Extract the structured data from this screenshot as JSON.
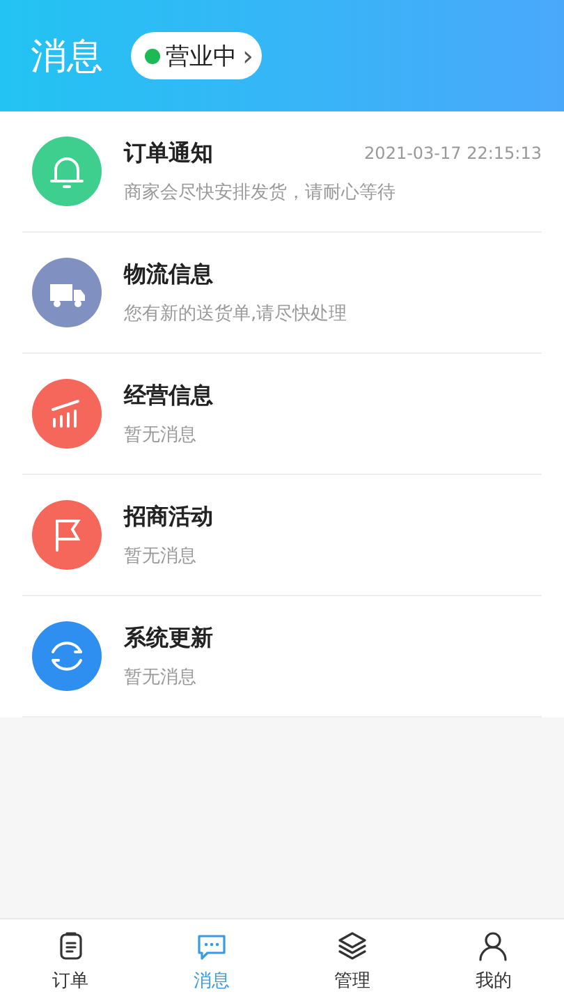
{
  "header": {
    "title": "消息",
    "status": {
      "label": "营业中",
      "open": true,
      "chevron": "›"
    }
  },
  "messages": [
    {
      "kind": "bell",
      "color": "#3ecf8e",
      "title": "订单通知",
      "time": "2021-03-17 22:15:13",
      "preview": "商家会尽快安排发货，请耐心等待"
    },
    {
      "kind": "truck",
      "color": "#8090c0",
      "title": "物流信息",
      "preview": "您有新的送货单,请尽快处理"
    },
    {
      "kind": "chart",
      "color": "#f4675a",
      "title": "经营信息",
      "preview": "暂无消息"
    },
    {
      "kind": "flag",
      "color": "#f4675a",
      "title": "招商活动",
      "preview": "暂无消息"
    },
    {
      "kind": "refresh",
      "color": "#2e8ff0",
      "title": "系统更新",
      "preview": "暂无消息"
    }
  ],
  "tabs": [
    {
      "kind": "clipboard",
      "label": "订单",
      "selected": false
    },
    {
      "kind": "chat",
      "label": "消息",
      "selected": true
    },
    {
      "kind": "layers",
      "label": "管理",
      "selected": false
    },
    {
      "kind": "user",
      "label": "我的",
      "selected": false
    }
  ]
}
